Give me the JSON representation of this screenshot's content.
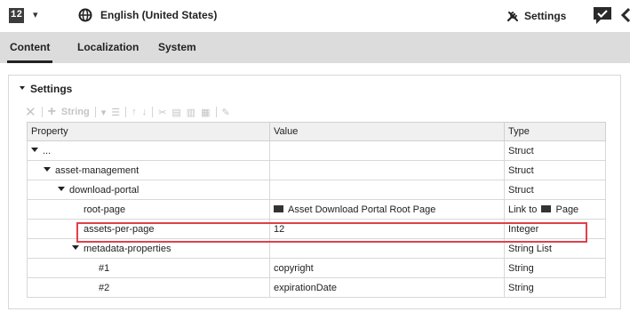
{
  "topbar": {
    "identifier": "12",
    "locale": "English (United States)",
    "settings_label": "Settings"
  },
  "tabs": [
    {
      "label": "Content",
      "active": true
    },
    {
      "label": "Localization",
      "active": false
    },
    {
      "label": "System",
      "active": false
    }
  ],
  "panel": {
    "title": "Settings",
    "toolbar": {
      "add_label": "String"
    },
    "columns": {
      "property": "Property",
      "value": "Value",
      "type": "Type"
    },
    "rows": [
      {
        "property": "...",
        "value": "",
        "type": "Struct",
        "expanded": true
      },
      {
        "property": "asset-management",
        "value": "",
        "type": "Struct",
        "expanded": true
      },
      {
        "property": "download-portal",
        "value": "",
        "type": "Struct",
        "expanded": true
      },
      {
        "property": "root-page",
        "value": "Asset Download Portal Root Page",
        "type": "Link to",
        "type_suffix": "Page"
      },
      {
        "property": "assets-per-page",
        "value": "12",
        "type": "Integer",
        "highlighted": true
      },
      {
        "property": "metadata-properties",
        "value": "",
        "type": "String List",
        "expanded": true
      },
      {
        "property": "#1",
        "value": "copyright",
        "type": "String"
      },
      {
        "property": "#2",
        "value": "expirationDate",
        "type": "String"
      }
    ]
  },
  "colors": {
    "highlight": "#e0404a",
    "tabbar": "#dcdcdc"
  }
}
